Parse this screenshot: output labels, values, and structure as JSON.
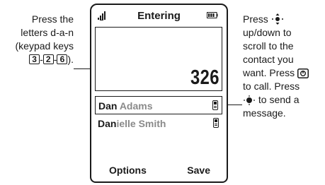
{
  "left_caption": {
    "line1": "Press the",
    "line2": "letters d-a-n",
    "line3": "(keypad keys",
    "key1": "3",
    "key2": "2",
    "key3": "6",
    "sep1": "-",
    "sep2": "-",
    "end": ")."
  },
  "phone": {
    "title": "Entering",
    "entry": "326",
    "contacts": [
      {
        "match": "Dan",
        "rest": " Adams"
      },
      {
        "match": "Dan",
        "rest": "ielle Smith"
      }
    ],
    "softkey_left": "Options",
    "softkey_right": "Save"
  },
  "right_caption": {
    "line1_pre": "Press",
    "line2": "up/down to",
    "line3": "scroll to the",
    "line4": "contact you",
    "line5_pre": "want. Press",
    "line6": "to call. Press",
    "line7_post": "to send a",
    "line8": "message."
  },
  "icons": {
    "signal": "signal-strength-icon",
    "battery": "battery-icon",
    "contact_phone": "phone-handset-icon",
    "nav": "nav-key-icon",
    "send": "send-key-icon"
  },
  "colors": {
    "ink": "#1a1a1a",
    "dim_text": "#8a8a8a"
  }
}
